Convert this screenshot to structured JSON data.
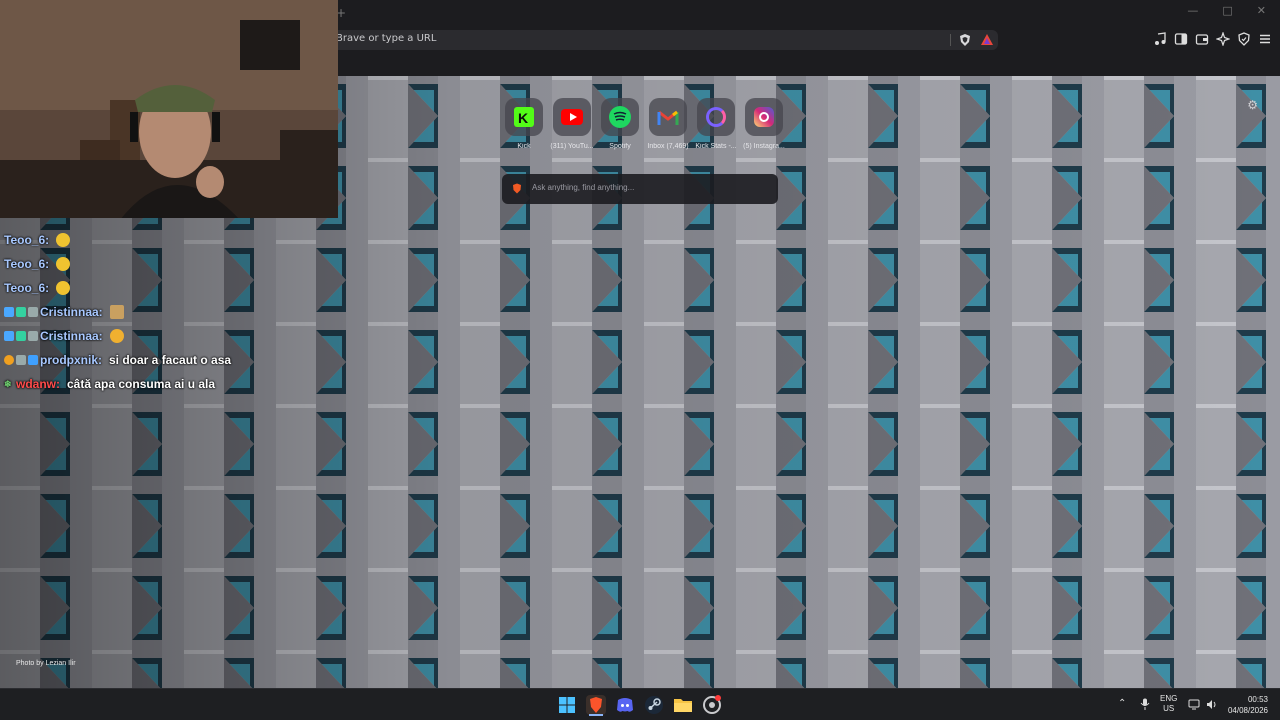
{
  "browser": {
    "omnibox_placeholder": "Brave or type a URL"
  },
  "ntp": {
    "shortcuts": [
      {
        "label": "Kick",
        "icon": "kick-icon",
        "color": "#53fc18"
      },
      {
        "label": "(311) YouTu...",
        "icon": "youtube-icon",
        "color": "#ff0000"
      },
      {
        "label": "Spotify",
        "icon": "spotify-icon",
        "color": "#1ed760"
      },
      {
        "label": "Inbox (7,469)",
        "icon": "gmail-icon",
        "color": "#ea4335"
      },
      {
        "label": "Kick Stats -...",
        "icon": "kickstats-icon",
        "color": "#7b61ff"
      },
      {
        "label": "(5) Instagra...",
        "icon": "instagram-icon",
        "color": "#e1306c"
      }
    ],
    "search_placeholder": "Ask anything, find anything...",
    "photo_credit": "Photo by Lezian Ilir"
  },
  "chat": {
    "messages": [
      {
        "user": "Teoo_6:",
        "user_color": "#a8c8ff",
        "message": "",
        "emote": "emoji-face"
      },
      {
        "user": "Teoo_6:",
        "user_color": "#a8c8ff",
        "message": "",
        "emote": "emoji-face"
      },
      {
        "user": "Teoo_6:",
        "user_color": "#a8c8ff",
        "message": "",
        "emote": "emoji-face"
      },
      {
        "user": "Cristinnaa:",
        "user_color": "#a8c8ff",
        "message": "",
        "emote": "emoji-sticker"
      },
      {
        "user": "Cristinnaa:",
        "user_color": "#a8c8ff",
        "message": "",
        "emote": "emoji-sticker"
      },
      {
        "user": "prodpxnik:",
        "user_color": "#a8c8ff",
        "message": "si doar a facaut o asa",
        "emote": ""
      },
      {
        "user": "wdanw:",
        "user_color": "#ff4b4b",
        "message": "câtă apa consuma ai u ala",
        "emote": ""
      }
    ]
  },
  "taskbar": {
    "apps": [
      "windows-start-icon",
      "brave-icon",
      "discord-icon",
      "steam-icon",
      "file-explorer-icon",
      "chrome-like-icon"
    ],
    "lang_top": "ENG",
    "lang_bottom": "US",
    "time": "00:53",
    "date": "04/08/2026"
  }
}
